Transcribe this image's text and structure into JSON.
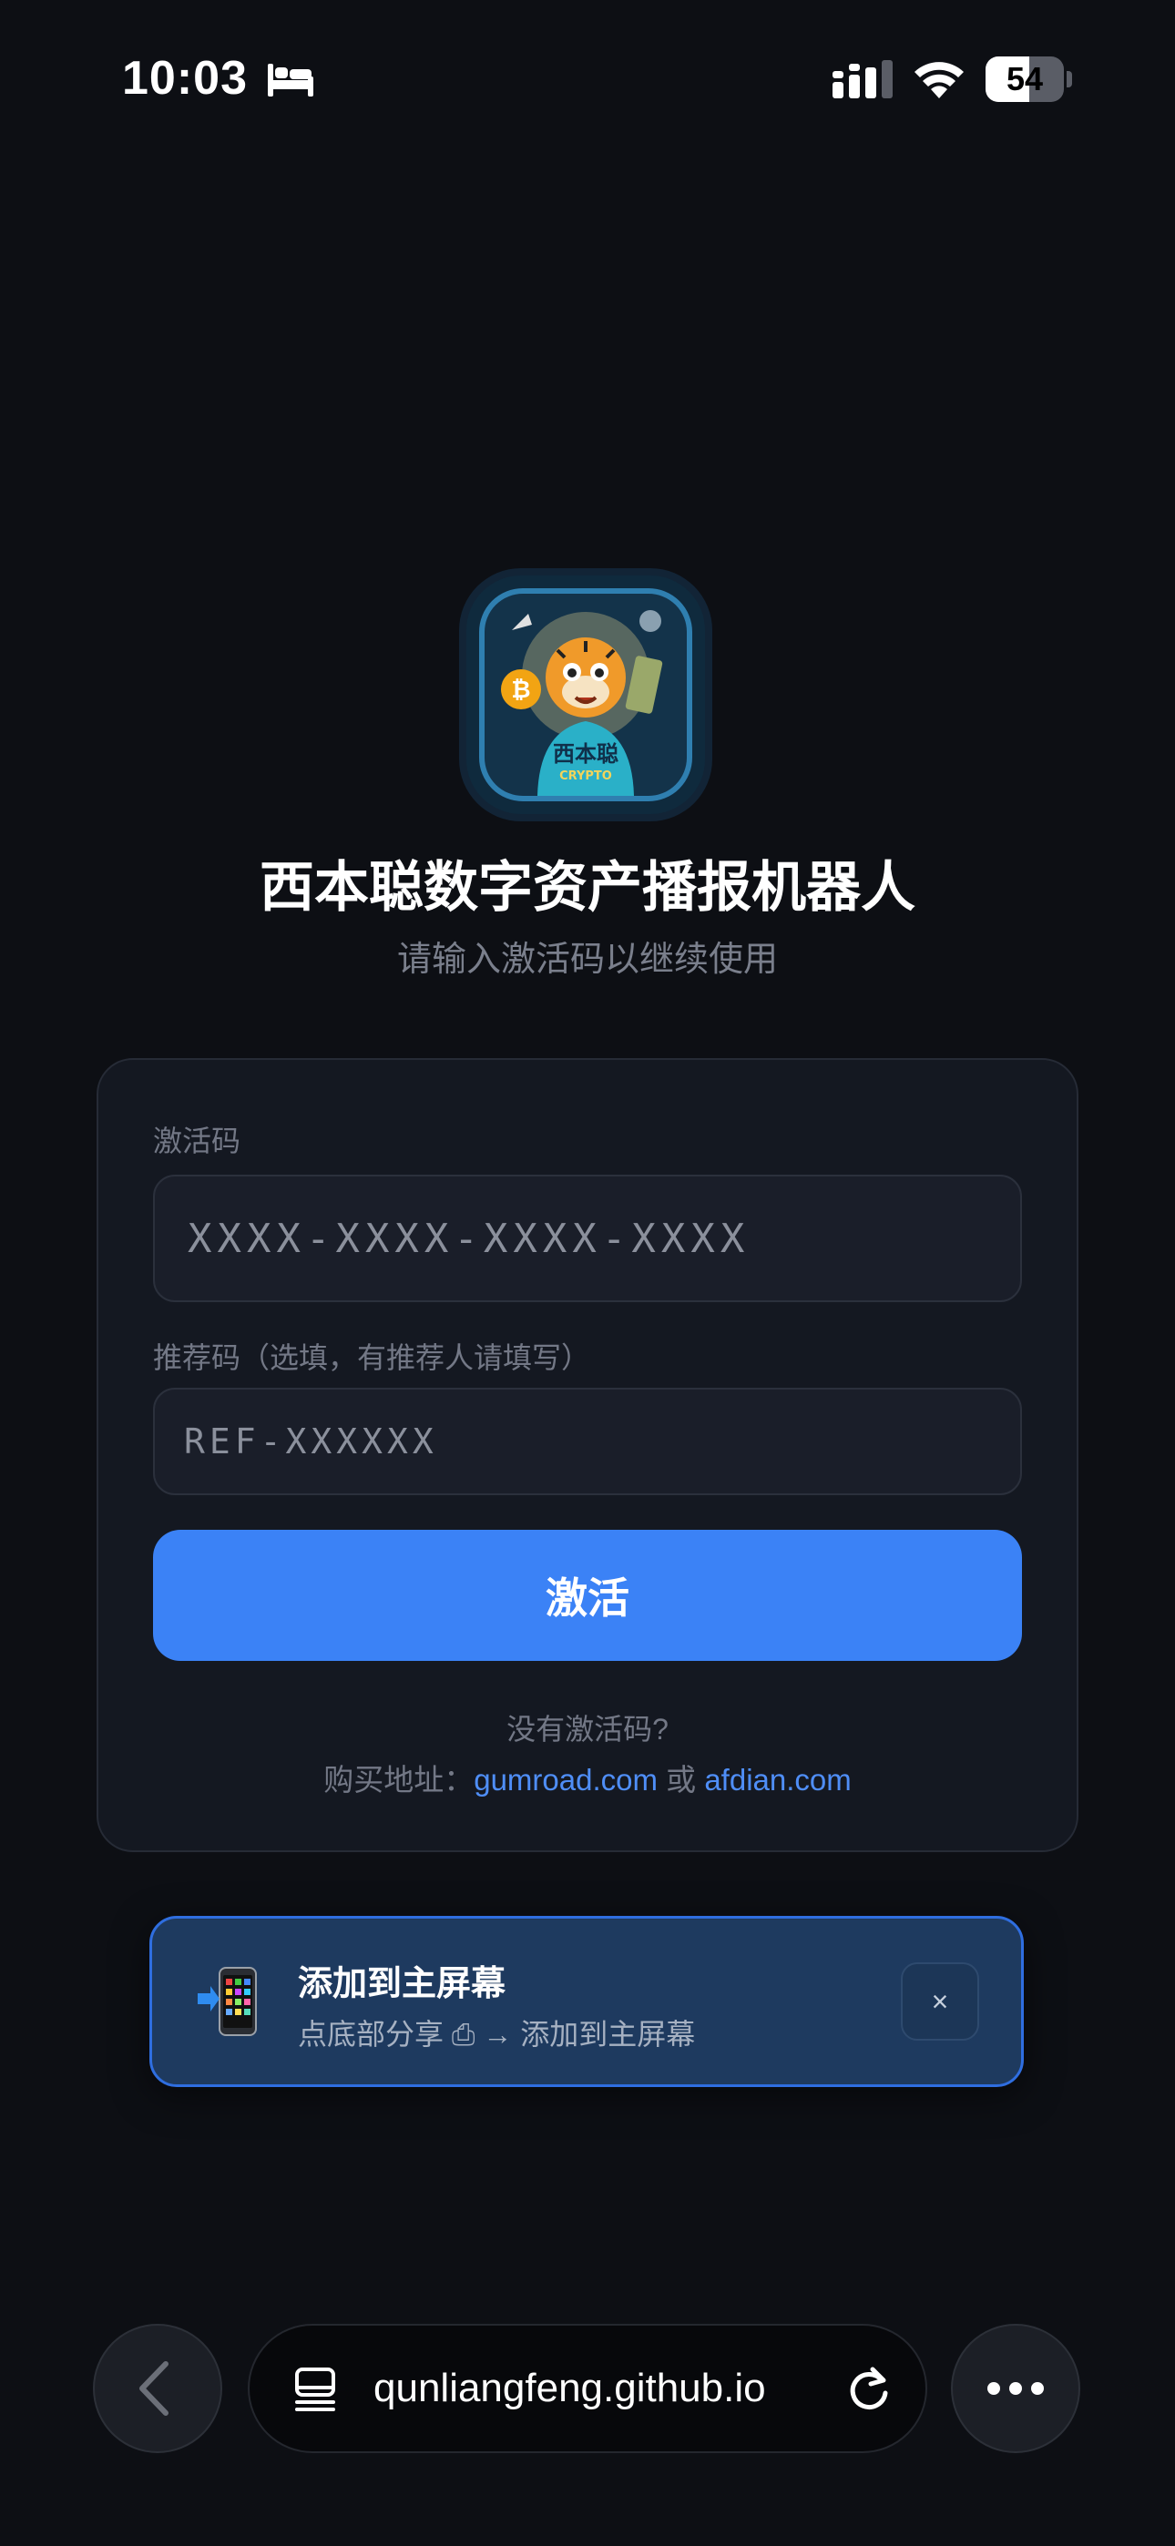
{
  "status_bar": {
    "time": "10:03",
    "battery": "54"
  },
  "app": {
    "logo_text": "西本聪",
    "logo_subtext": "CRYPTO",
    "title": "西本聪数字资产播报机器人",
    "subtitle": "请输入激活码以继续使用"
  },
  "form": {
    "activation_label": "激活码",
    "activation_placeholder": "XXXX-XXXX-XXXX-XXXX",
    "referral_label": "推荐码（选填，有推荐人请填写）",
    "referral_placeholder": "REF-XXXXXX",
    "activate_button": "激活",
    "no_code_text": "没有激活码?",
    "buy_prefix": "购买地址：",
    "buy_link_1": "gumroad.com",
    "buy_or": " 或 ",
    "buy_link_2": "afdian.com"
  },
  "banner": {
    "title": "添加到主屏幕",
    "desc": "点底部分享 ⎙ → 添加到主屏幕",
    "close": "×"
  },
  "browser": {
    "url": "qunliangfeng.github.io"
  },
  "colors": {
    "accent": "#3b82f6",
    "background": "#0d0f14",
    "card": "#141821",
    "banner": "#1e3a5f"
  }
}
